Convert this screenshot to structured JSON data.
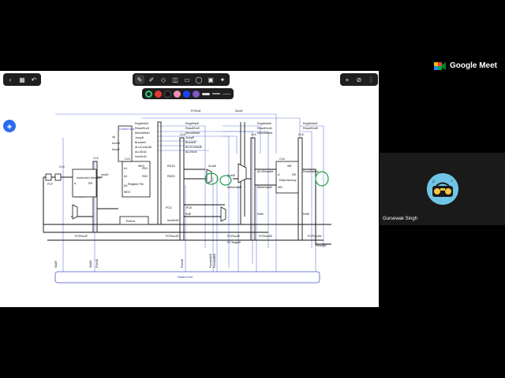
{
  "meet": {
    "brand": "Google Meet"
  },
  "participant": {
    "name": "Gursewak Singh"
  },
  "toolbar": {
    "left": [
      "chevron-left-icon",
      "grid-icon",
      "undo-icon"
    ],
    "main": [
      "pen-icon",
      "marker-icon",
      "eraser-icon",
      "shape-icon",
      "textbox-icon",
      "sticky-note-icon",
      "image-icon",
      "laser-icon"
    ],
    "right": [
      "plus-icon",
      "clear-icon",
      "more-icon"
    ]
  },
  "palette": {
    "colors": [
      "#2ecc71",
      "#e53935",
      "#111111",
      "#f48fb1",
      "#1e40ff",
      "#7e57c2",
      "#bdbdbd"
    ]
  },
  "diagram": {
    "labels": {
      "control_unit": "Control Unit",
      "instruction_memory": "Instruction Memory",
      "register_file": "Register File",
      "data_memory": "Data Memory",
      "extend": "Extend",
      "hazard_unit": "Hazard Unit",
      "clk": "CLK",
      "zero": "ZeroE",
      "pcsrc": "PCSrcE",
      "pcf": "PCF",
      "pcd": "PCD",
      "pce": "PCE",
      "pcplus4f": "PCPlus4F",
      "pcplus4d": "PCPlus4D",
      "pcplus4e": "PCPlus4E",
      "pcplus4m": "PCPlus4M",
      "pcplus4w": "PCPlus4W",
      "pctargete": "PCTargetE",
      "instrd": "InstrD",
      "aluresultm": "ALUResultM",
      "aluresultw": "ALUResultW",
      "readdataw": "ReadDataW",
      "writedatae": "WriteDataE",
      "writedatam": "WriteDataM",
      "resultw": "ResultW",
      "rd1d": "RD1D",
      "rd2d": "RD2D",
      "rde": "RdE",
      "rdm": "RdM",
      "rdw": "RdW",
      "regwrited": "RegWriteD",
      "resultsrcd": "ResultSrcD",
      "memwrited": "MemWriteD",
      "jumpd": "JumpD",
      "branchd": "BranchD",
      "alucontrold": "ALUControlD",
      "alusrcd": "ALUSrcD",
      "immsrcd": "ImmSrcD",
      "regwritee": "RegWriteE",
      "resultsrce": "ResultSrcE",
      "memwritee": "MemWriteE",
      "jumpe": "JumpE",
      "branche": "BranchE",
      "alucontrole": "ALUControlE",
      "alusrce": "ALUSrcE",
      "regwritem": "RegWriteM",
      "resultsrcm": "ResultSrcM",
      "memwritem": "MemWriteM",
      "regwritew": "RegWriteW",
      "resultsrcw": "ResultSrcW",
      "we3": "WE3",
      "we": "WE",
      "a": "A",
      "a1": "A1",
      "a2": "A2",
      "a3": "A3",
      "wd": "WD",
      "wd3": "WD3",
      "rd": "RD",
      "rd1": "RD1",
      "rd2": "RD2",
      "op": "op",
      "funct3": "funct3",
      "funct7": "funct7",
      "imm": "ImmExtD",
      "stallf": "StallF",
      "stalld": "StallD",
      "flushd": "FlushD",
      "flushe": "FlushE",
      "forwardae": "ForwardAE",
      "forwardbe": "ForwardBE",
      "srcae": "SrcAE",
      "srcbe": "SrcBE"
    }
  }
}
